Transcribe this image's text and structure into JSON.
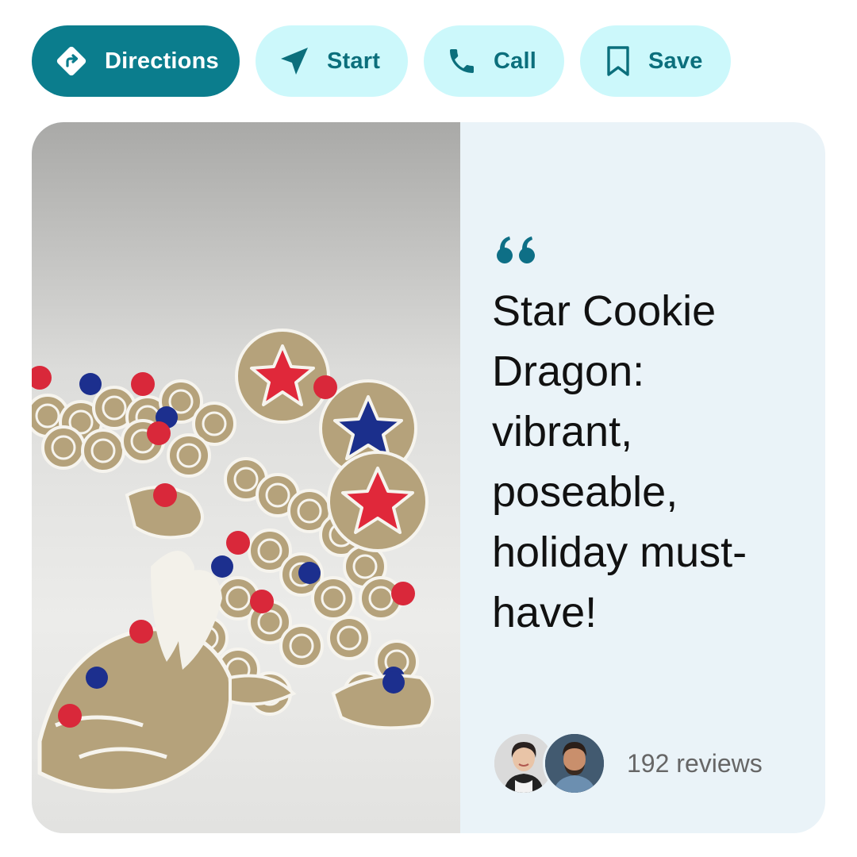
{
  "actions": {
    "directions": {
      "label": "Directions",
      "icon": "directions-diamond-icon"
    },
    "start": {
      "label": "Start",
      "icon": "navigation-arrow-icon"
    },
    "call": {
      "label": "Call",
      "icon": "phone-icon"
    },
    "save": {
      "label": "Save",
      "icon": "bookmark-icon"
    }
  },
  "card": {
    "image": {
      "subject": "product-photo",
      "icon": "dragon-photo"
    },
    "quote_icon": "quote-icon",
    "quote": "Star Cookie Dragon: vibrant, poseable, holiday must-have!",
    "reviews": {
      "count_label": "192 reviews",
      "avatars": [
        "reviewer-avatar-woman",
        "reviewer-avatar-man"
      ]
    }
  },
  "colors": {
    "primary": "#0b7d8d",
    "secondary_bg": "#ccf8fb",
    "secondary_text": "#0b6f7c",
    "card_bg": "#eaf3f8",
    "quote_mark": "#0e6f86",
    "star_red": "#e0283a",
    "star_blue": "#1b2f8c",
    "cookie_tan": "#b4a27c"
  }
}
